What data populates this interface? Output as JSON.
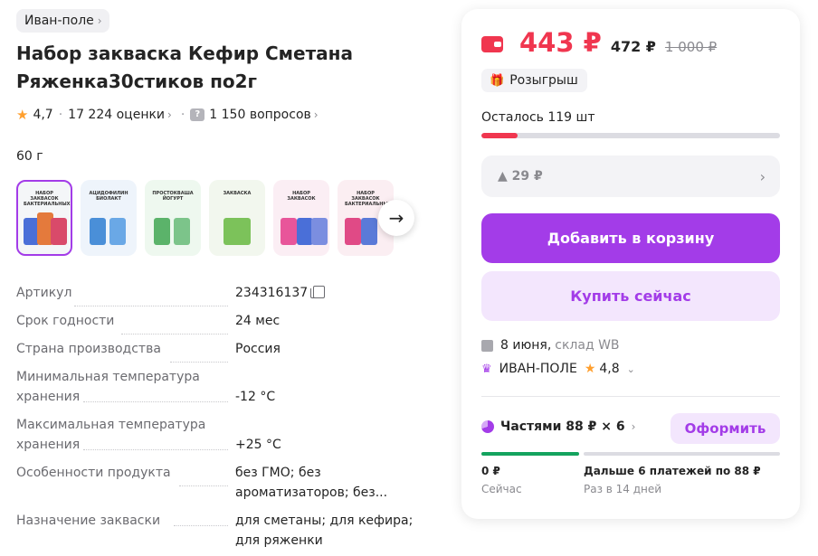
{
  "breadcrumb": {
    "brand": "Иван-поле",
    "chevron": "›"
  },
  "product": {
    "title": "Набор закваска Кефир Сметана Ряженка30стиков по2г",
    "rating": "4,7",
    "reviews": "17 224 оценки",
    "questions": "1 150 вопросов",
    "weight": "60 г"
  },
  "thumbnails": [
    {
      "caption": "НАБОР ЗАКВАСОК БАКТЕРИАЛЬНЫХ",
      "accent": "#e47a3c"
    },
    {
      "caption": "АЦИДОФИЛИН БИОЛАКТ",
      "accent": "#4a8fd8"
    },
    {
      "caption": "ПРОСТОКВАША ЙОГУРТ",
      "accent": "#5bb36a"
    },
    {
      "caption": "ЗАКВАСКА",
      "accent": "#7cc25a"
    },
    {
      "caption": "НАБОР ЗАКВАСОК",
      "accent": "#e8559a"
    },
    {
      "caption": "НАБОР ЗАКВАСОК БАКТЕРИАЛЬНЫХ",
      "accent": "#e04a86"
    }
  ],
  "specs": [
    {
      "label": "Артикул",
      "value": "234316137"
    },
    {
      "label": "Срок годности",
      "value": "24 мес"
    },
    {
      "label": "Страна производства",
      "value": "Россия"
    },
    {
      "label": "Минимальная температура хранения",
      "value": "-12 °C"
    },
    {
      "label": "Максимальная температура хранения",
      "value": "+25 °C"
    },
    {
      "label": "Особенности продукта",
      "value": "без ГМО; без ароматизаторов; без..."
    },
    {
      "label": "Назначение закваски",
      "value": "для сметаны; для кефира; для ряженки"
    }
  ],
  "buy_card": {
    "price": "443 ₽",
    "price_wallet_less": "472 ₽",
    "price_old": "1 000 ₽",
    "promo": "Розыгрыш",
    "stock": "Осталось 119 шт",
    "stock_fill": 0.12,
    "discount": "▲ 29 ₽",
    "add_to_cart": "Добавить в корзину",
    "buy_now": "Купить сейчас",
    "delivery_date": "8 июня,",
    "delivery_place": "склад WB",
    "seller": "ИВАН-ПОЛЕ",
    "seller_rating": "4,8",
    "installments": "Частями 88 ₽ × 6",
    "checkout": "Оформить",
    "pay_now": "0 ₽",
    "pay_now_sub": "Сейчас",
    "pay_later": "Дальше 6 платежей по 88 ₽",
    "pay_later_sub": "Раз в 14 дней"
  },
  "colors": {
    "accent": "#a33ce8",
    "price": "#f0364f",
    "success": "#14a35e",
    "star": "#ff9f2e"
  }
}
